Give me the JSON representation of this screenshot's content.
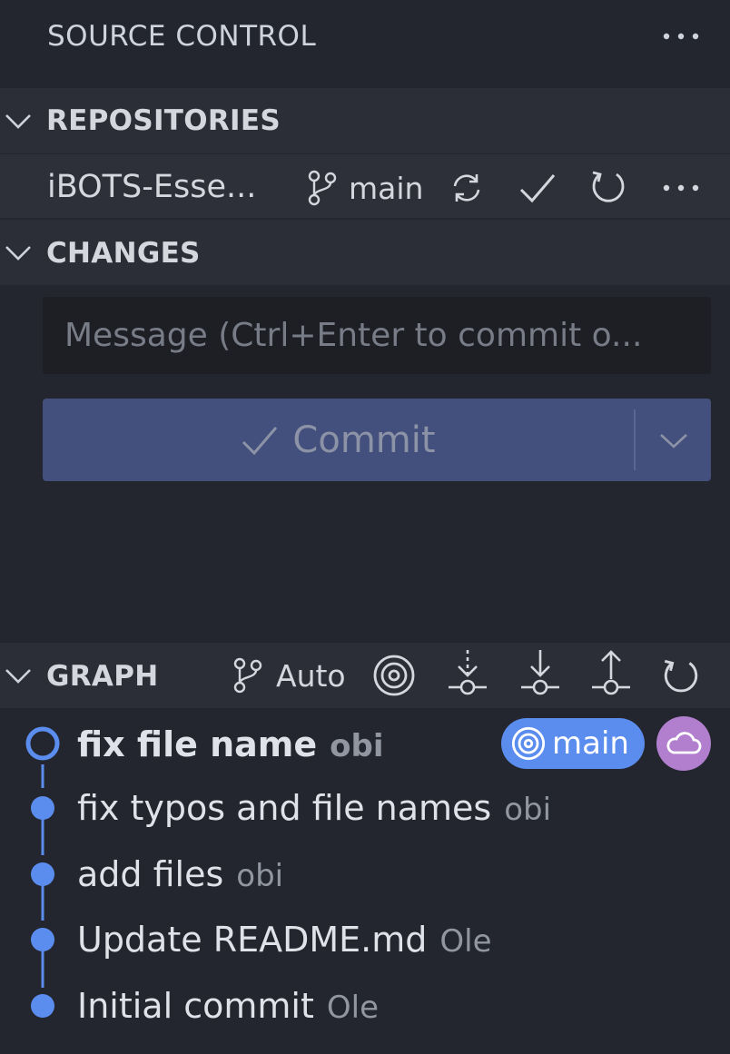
{
  "header": {
    "title": "SOURCE CONTROL",
    "more_icon": "ellipsis-icon"
  },
  "repositories": {
    "title": "REPOSITORIES",
    "repo": {
      "name": "iBOTS-Esse...",
      "branch": "main"
    }
  },
  "changes": {
    "title": "CHANGES",
    "message_placeholder": "Message (Ctrl+Enter to commit o...",
    "commit_label": "Commit"
  },
  "graph": {
    "title": "GRAPH",
    "mode": "Auto",
    "commits": [
      {
        "message": "fix file name",
        "author": "obi",
        "current": true
      },
      {
        "message": "fix typos and file names",
        "author": "obi"
      },
      {
        "message": "add files",
        "author": "obi"
      },
      {
        "message": "Update README.md",
        "author": "Ole"
      },
      {
        "message": "Initial commit",
        "author": "Ole"
      }
    ],
    "badge": {
      "label": "main"
    }
  },
  "colors": {
    "background": "#23262e",
    "section_header": "#2b2e37",
    "commit_button": "#434f7c",
    "graph_line": "#5b8def",
    "remote_badge": "#b27fcf"
  }
}
